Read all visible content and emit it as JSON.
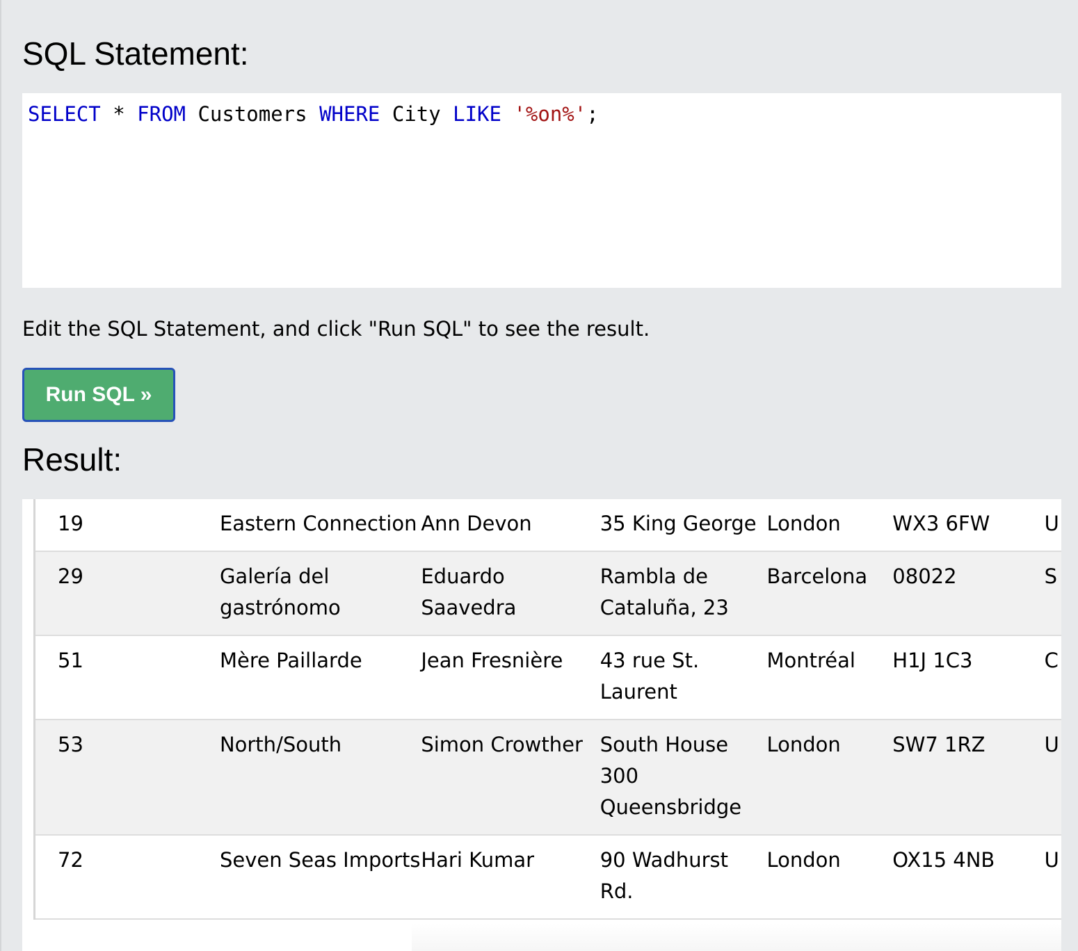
{
  "headings": {
    "sql_statement": "SQL Statement:",
    "result": "Result:"
  },
  "editor": {
    "tokens": [
      {
        "text": "SELECT",
        "kind": "keyword"
      },
      {
        "text": " * ",
        "kind": "plain"
      },
      {
        "text": "FROM",
        "kind": "keyword"
      },
      {
        "text": " Customers ",
        "kind": "plain"
      },
      {
        "text": "WHERE",
        "kind": "keyword"
      },
      {
        "text": " City ",
        "kind": "plain"
      },
      {
        "text": "LIKE",
        "kind": "keyword"
      },
      {
        "text": " ",
        "kind": "plain"
      },
      {
        "text": "'%on%'",
        "kind": "string"
      },
      {
        "text": ";",
        "kind": "plain"
      }
    ]
  },
  "instructions": "Edit the SQL Statement, and click \"Run SQL\" to see the result.",
  "run_button": {
    "label": "Run SQL »"
  },
  "colors": {
    "keyword": "#0000c9",
    "string": "#a31515",
    "button_bg": "#4fac70",
    "button_border": "#2752b8",
    "page_bg": "#e7e9eb"
  },
  "result": {
    "rows": [
      [
        "19",
        "Eastern Connection",
        "Ann Devon",
        "35 King George",
        "London",
        "WX3 6FW",
        "U"
      ],
      [
        "29",
        "Galería del gastrónomo",
        "Eduardo Saavedra",
        "Rambla de Cataluña, 23",
        "Barcelona",
        "08022",
        "S"
      ],
      [
        "51",
        "Mère Paillarde",
        "Jean Fresnière",
        "43 rue St. Laurent",
        "Montréal",
        "H1J 1C3",
        "C"
      ],
      [
        "53",
        "North/South",
        "Simon Crowther",
        "South House 300 Queensbridge",
        "London",
        "SW7 1RZ",
        "U"
      ],
      [
        "72",
        "Seven Seas Imports",
        "Hari Kumar",
        "90 Wadhurst Rd.",
        "London",
        "OX15 4NB",
        "U"
      ]
    ]
  }
}
